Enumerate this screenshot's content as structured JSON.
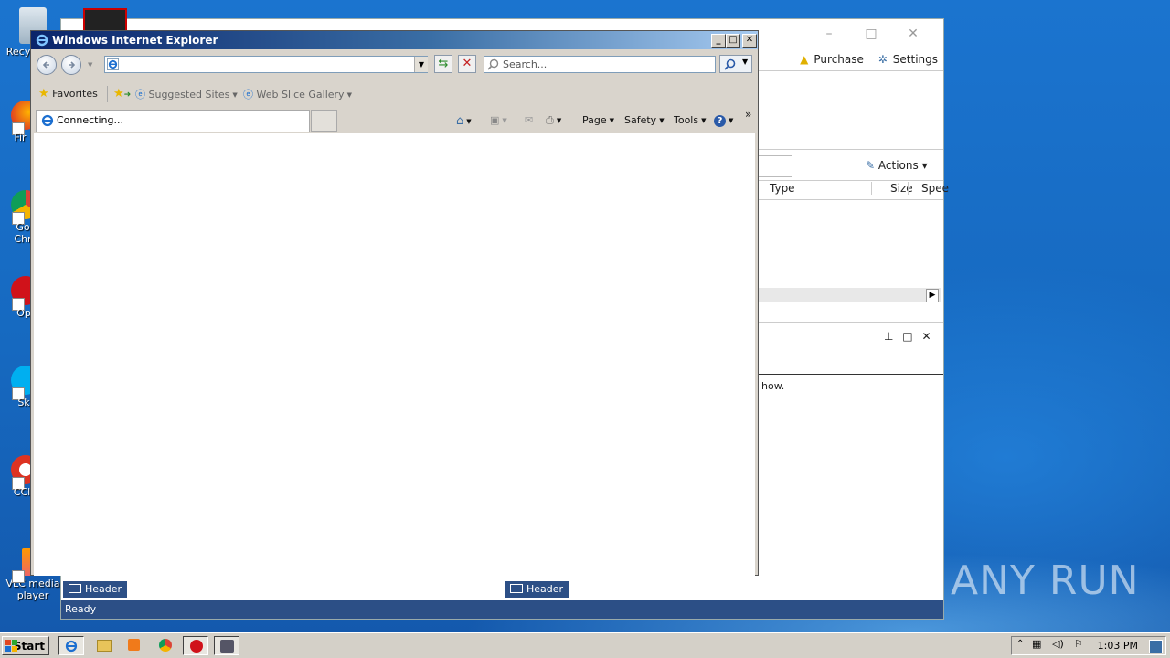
{
  "desktop": {
    "icons": [
      {
        "label": "Recy"
      },
      {
        "label": "Fir"
      },
      {
        "label": "Go Chr"
      },
      {
        "label": "Op"
      },
      {
        "label": "Sk"
      },
      {
        "label": "CCl"
      },
      {
        "label": "VLC media player"
      }
    ]
  },
  "background_app": {
    "links": {
      "purchase": "Purchase",
      "settings": "Settings"
    },
    "actions_label": "Actions",
    "columns": [
      "Type",
      "Size",
      "Spee"
    ],
    "pane_text": "how.",
    "header_tabs": [
      "Header",
      "Header"
    ],
    "status": "Ready"
  },
  "ie": {
    "title": "Windows Internet Explorer",
    "address_value": "",
    "search_placeholder": "Search...",
    "favorites_label": "Favorites",
    "suggested_sites": "Suggested Sites",
    "web_slice_gallery": "Web Slice Gallery",
    "tab_label": "Connecting...",
    "commands": {
      "page": "Page",
      "safety": "Safety",
      "tools": "Tools"
    },
    "chevron": "»"
  },
  "watermark": "ANY RUN",
  "taskbar": {
    "start_label": "Start",
    "clock": "1:03 PM"
  },
  "colors": {
    "desktop_blue": "#1a6fc4",
    "ie_titlebar": "#0a246a",
    "header_tab": "#2c4f86",
    "status_bar": "#2c4f86"
  }
}
